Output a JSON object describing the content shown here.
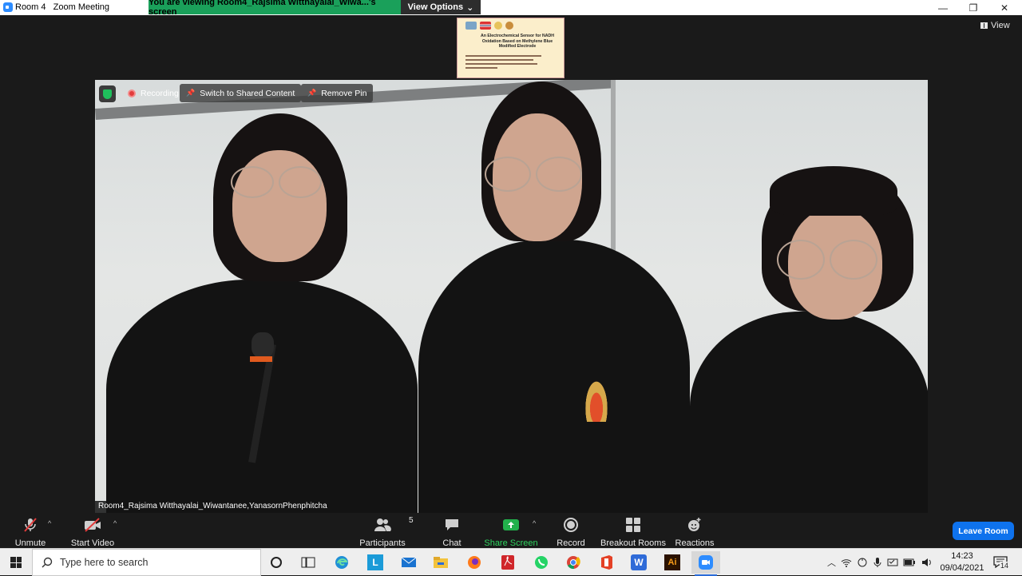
{
  "window": {
    "title": "Room 4   Zoom Meeting",
    "controls": [
      "—",
      "❐",
      "✕"
    ]
  },
  "share_banner": {
    "text": "You are viewing Room4_Rajsima Witthayalai_Wiwa...'s screen",
    "view_options_label": "View Options",
    "view_options_caret": "⌄"
  },
  "view_button": {
    "label": "View"
  },
  "shared_thumbnail": {
    "title": "An Electrochemical Sensor for NADH Oxidation Based on Methylene Blue Modified Electrode"
  },
  "video_overlay": {
    "recording_label": "Recording",
    "switch_label": "Switch to Shared Content",
    "remove_pin_label": "Remove Pin"
  },
  "participant_name": "Room4_Rajsima Witthayalai_Wiwantanee,YanasornPhenphitcha",
  "toolbar": {
    "unmute": "Unmute",
    "start_video": "Start Video",
    "participants": "Participants",
    "participants_count": "5",
    "chat": "Chat",
    "share_screen": "Share Screen",
    "record": "Record",
    "breakout_rooms": "Breakout Rooms",
    "reactions": "Reactions",
    "leave": "Leave Room",
    "caret": "^"
  },
  "taskbar": {
    "search_placeholder": "Type here to search",
    "time": "14:23",
    "date": "09/04/2021",
    "notification_count": "14",
    "apps": [
      "cortana",
      "task-view",
      "edge",
      "lexicon",
      "mail",
      "file-explorer",
      "firefox",
      "acrobat",
      "whatsapp",
      "chrome",
      "office",
      "wps-writer",
      "illustrator",
      "zoom"
    ],
    "illustrator_label": "Ai",
    "lexicon_label": "L",
    "writer_label": "W"
  },
  "colors": {
    "share_banner_bg": "#1aa05a",
    "leave_button_bg": "#0e72ed",
    "share_screen_green": "#22b14c",
    "recording_red": "#e23c3c",
    "toolbar_bg": "#1a1a1a"
  }
}
